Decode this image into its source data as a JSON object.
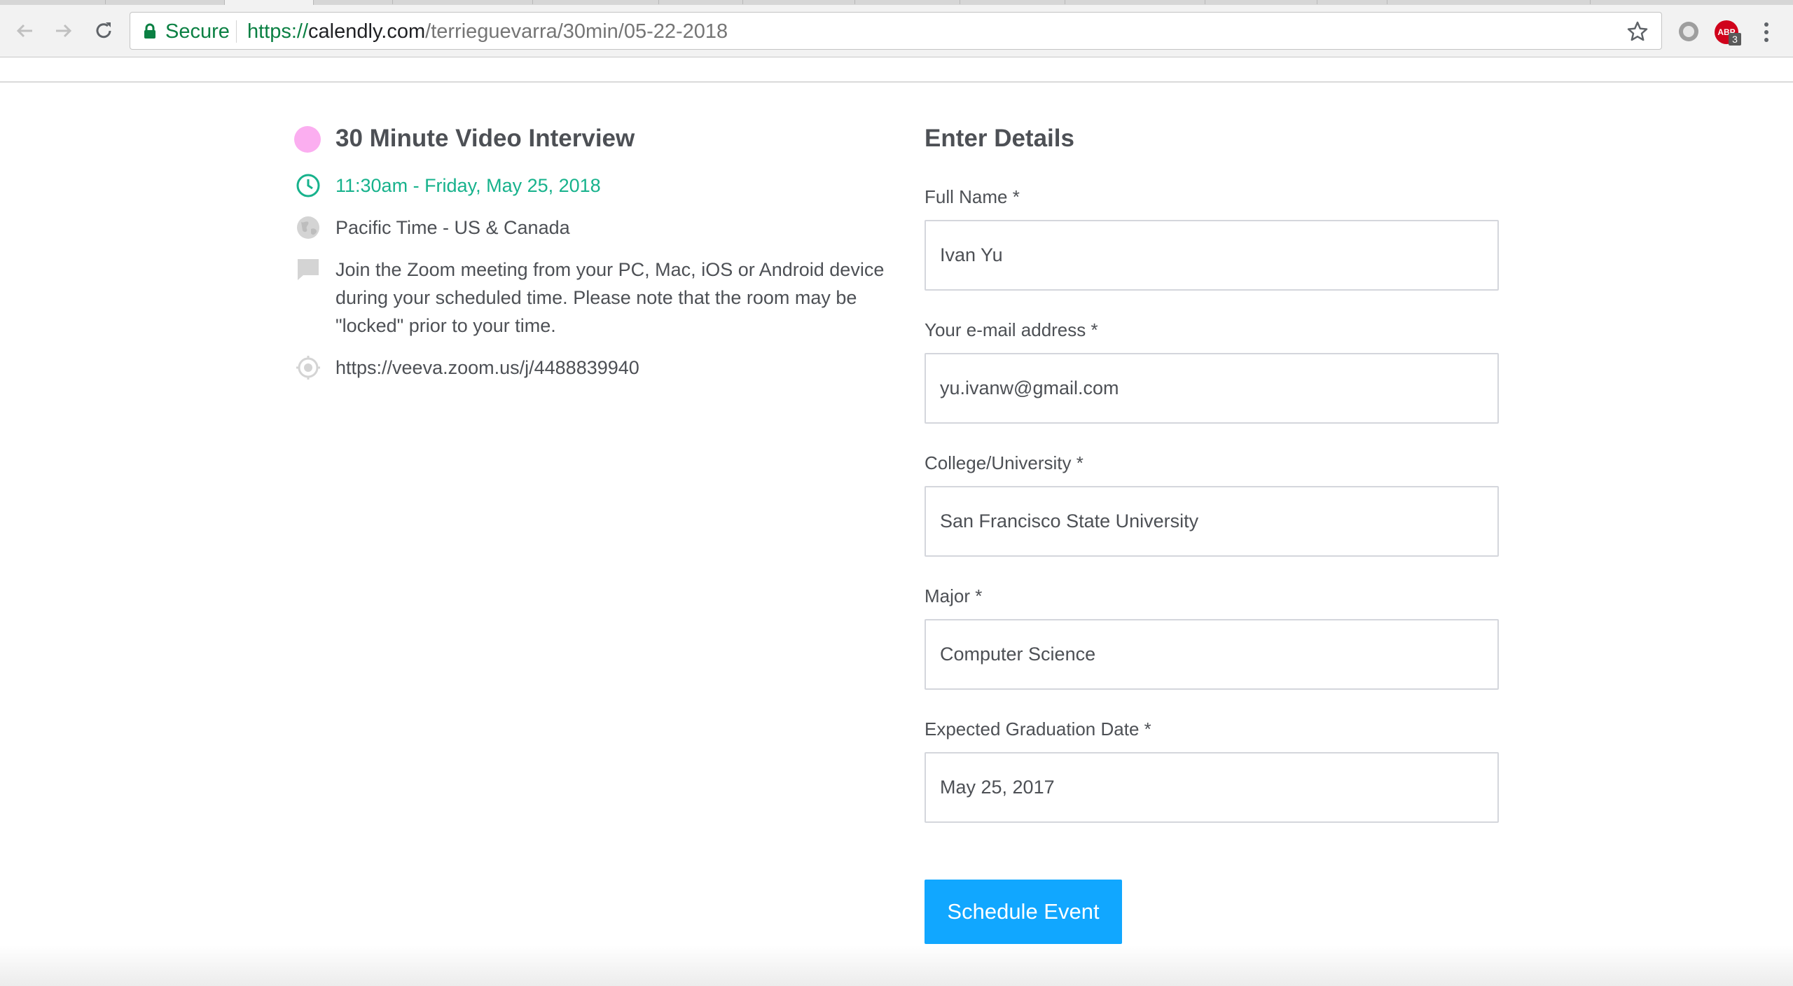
{
  "browser": {
    "secure_label": "Secure",
    "url_scheme": "https://",
    "url_host": "calendly.com",
    "url_path": "/terrieguevarra/30min/05-22-2018",
    "extension_badge_label": "ABP",
    "extension_badge_count": "3"
  },
  "event": {
    "color": "#fbaef0",
    "title": "30 Minute Video Interview",
    "time": "11:30am - Friday, May 25, 2018",
    "timezone": "Pacific Time - US & Canada",
    "description": "Join the Zoom meeting from your PC, Mac, iOS or Android device during your scheduled time. Please note that the room may be \"locked\" prior to your time.",
    "location": "https://veeva.zoom.us/j/4488839940"
  },
  "form": {
    "title": "Enter Details",
    "fields": [
      {
        "label": "Full Name *",
        "value": "Ivan Yu"
      },
      {
        "label": "Your e-mail address *",
        "value": "yu.ivanw@gmail.com"
      },
      {
        "label": "College/University *",
        "value": "San Francisco State University"
      },
      {
        "label": "Major *",
        "value": "Computer Science"
      },
      {
        "label": "Expected Graduation Date *",
        "value": "May 25, 2017"
      }
    ],
    "submit_label": "Schedule Event"
  },
  "colors": {
    "accent": "#11a7ff",
    "time_green": "#17b28c",
    "secure_green": "#0b8043"
  },
  "icons": [
    "back-arrow-icon",
    "forward-arrow-icon",
    "reload-icon",
    "lock-icon",
    "star-icon",
    "extension-icon",
    "adblock-icon",
    "menu-icon",
    "clock-icon",
    "globe-icon",
    "comment-icon",
    "location-icon"
  ]
}
